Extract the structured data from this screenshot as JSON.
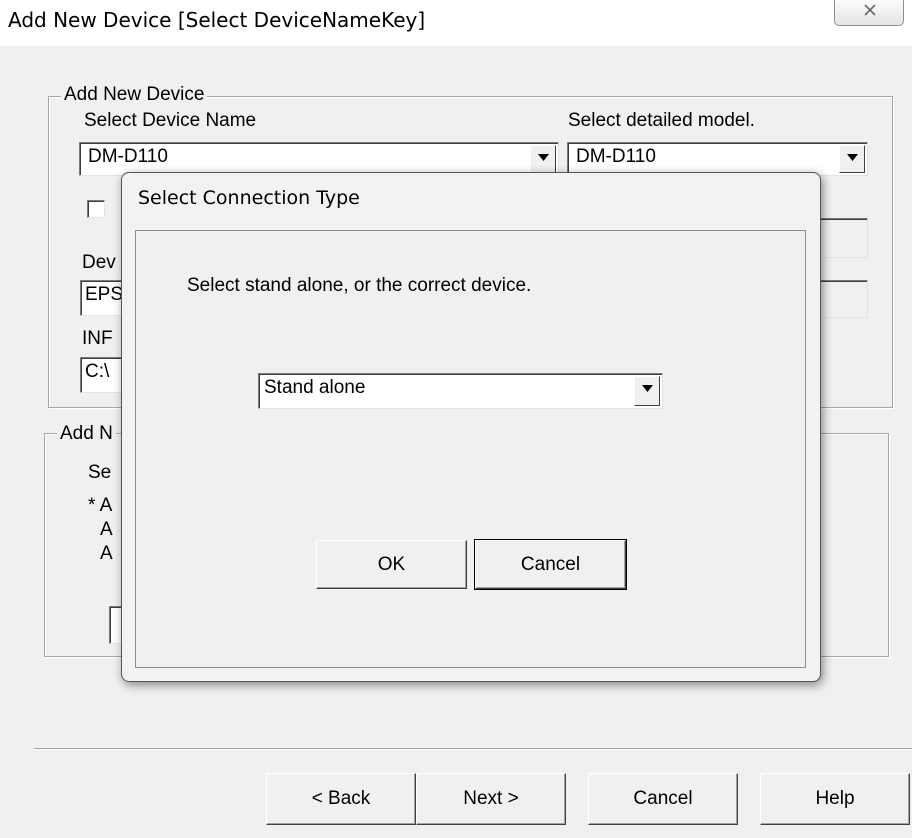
{
  "window": {
    "title": "Add New Device  [Select DeviceNameKey]",
    "close_icon": "close-icon"
  },
  "device_group": {
    "legend": "Add New Device",
    "device_name_label": "Select Device Name",
    "device_name_value": "DM-D110",
    "model_label": "Select detailed model.",
    "model_value": "DM-D110",
    "checkbox_label_partial": "",
    "device_label_partial": "Dev",
    "device_field_partial": "EPS",
    "inf_label_partial": "INF",
    "inf_field_partial": "C:\\"
  },
  "second_group": {
    "legend_partial": "Add N",
    "line1_partial": "Se",
    "line2_partial": "* A",
    "line3_partial": "A",
    "line4_partial": "A"
  },
  "footer": {
    "back": "< Back",
    "next": "Next >",
    "cancel": "Cancel",
    "help": "Help"
  },
  "modal": {
    "title": "Select Connection Type",
    "instruction": "Select stand alone, or the correct device.",
    "selected_option": "Stand alone",
    "ok": "OK",
    "cancel": "Cancel"
  }
}
